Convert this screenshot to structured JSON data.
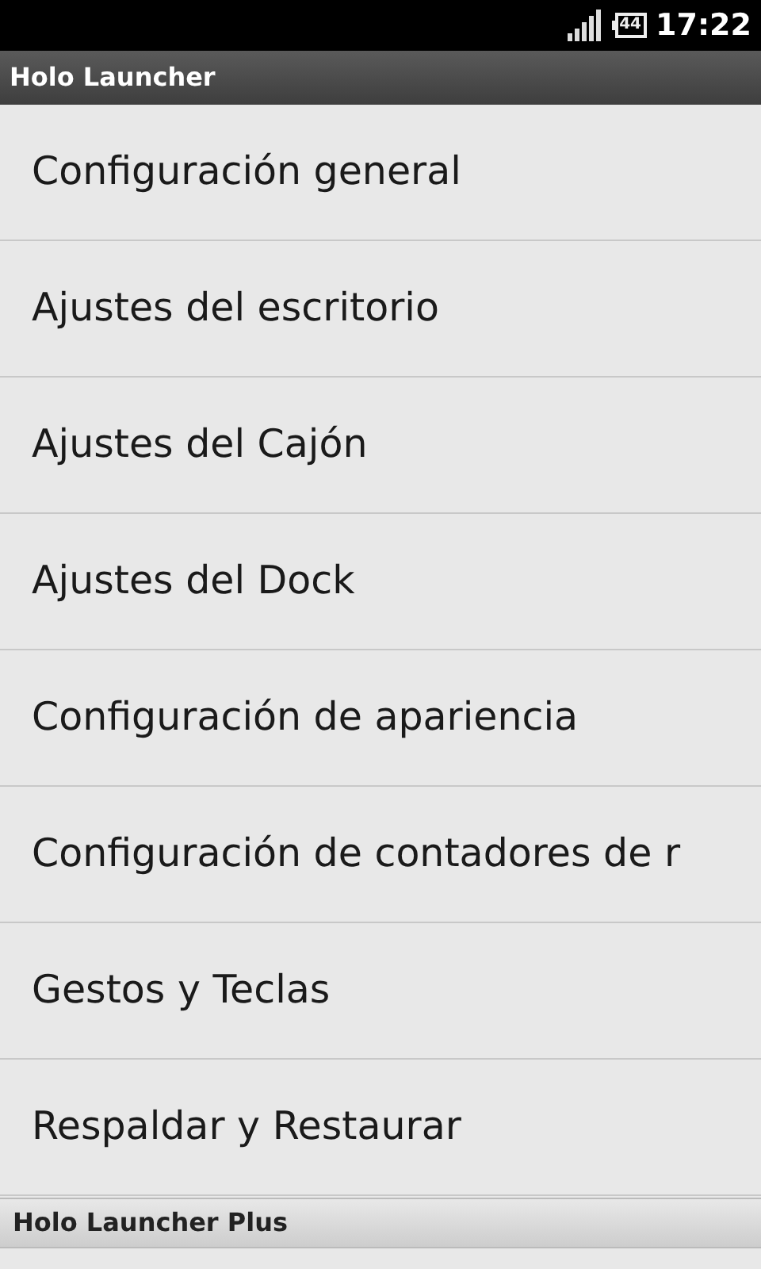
{
  "status_bar": {
    "battery": "44",
    "time": "17:22"
  },
  "title_bar": {
    "title": "Holo Launcher"
  },
  "items": [
    {
      "label": "Configuración general"
    },
    {
      "label": "Ajustes del escritorio"
    },
    {
      "label": "Ajustes del Cajón"
    },
    {
      "label": "Ajustes del Dock"
    },
    {
      "label": "Configuración de apariencia"
    },
    {
      "label": "Configuración de contadores de r"
    },
    {
      "label": "Gestos y Teclas"
    },
    {
      "label": "Respaldar y Restaurar"
    }
  ],
  "section_header": {
    "title": "Holo Launcher Plus"
  }
}
